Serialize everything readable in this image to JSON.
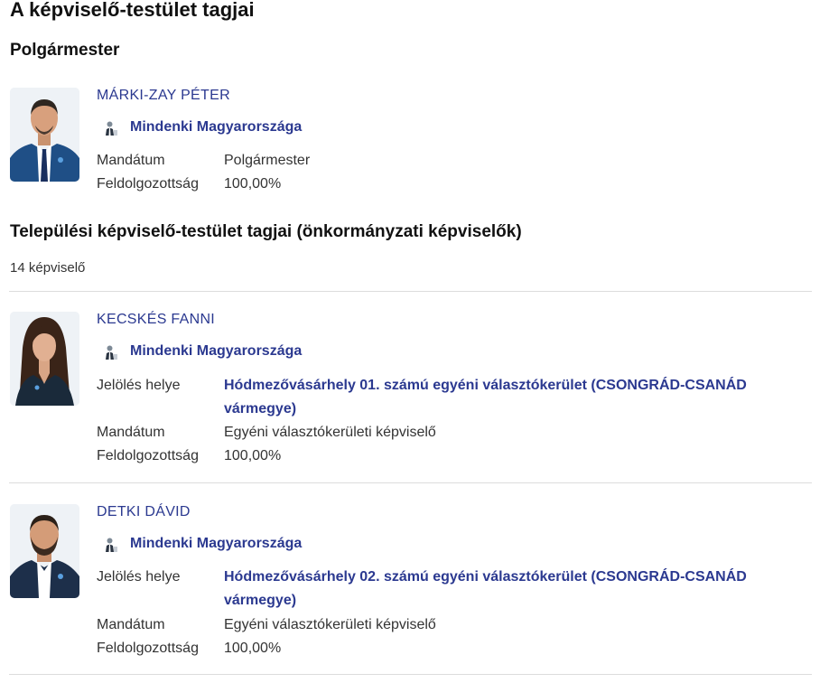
{
  "page_title": "A képviselő-testület tagjai",
  "mayor_section": {
    "title": "Polgármester",
    "members": [
      {
        "name": "MÁRKI-ZAY PÉTER",
        "party": "Mindenki Magyarországa",
        "mandate_label": "Mandátum",
        "mandate_value": "Polgármester",
        "processed_label": "Feldolgozottság",
        "processed_value": "100,00%"
      }
    ]
  },
  "council_section": {
    "title": "Települési képviselő-testület tagjai (önkormányzati képviselők)",
    "count_text": "14 képviselő",
    "members": [
      {
        "name": "KECSKÉS FANNI",
        "party": "Mindenki Magyarországa",
        "nomination_label": "Jelölés helye",
        "nomination_value": "Hódmezővásárhely 01. számú egyéni választókerület (CSONGRÁD-CSANÁD vármegye)",
        "mandate_label": "Mandátum",
        "mandate_value": "Egyéni választókerületi képviselő",
        "processed_label": "Feldolgozottság",
        "processed_value": "100,00%"
      },
      {
        "name": "DETKI DÁVID",
        "party": "Mindenki Magyarországa",
        "nomination_label": "Jelölés helye",
        "nomination_value": "Hódmezővásárhely 02. számú egyéni választókerület (CSONGRÁD-CSANÁD vármegye)",
        "mandate_label": "Mandátum",
        "mandate_value": "Egyéni választókerületi képviselő",
        "processed_label": "Feldolgozottság",
        "processed_value": "100,00%"
      }
    ]
  },
  "icons": {
    "party_logo": "party-logo-icon",
    "member_photo": "portrait-photo"
  },
  "colors": {
    "link": "#2b3990",
    "text": "#333333",
    "heading": "#111111",
    "divider": "#dcdcdc"
  }
}
